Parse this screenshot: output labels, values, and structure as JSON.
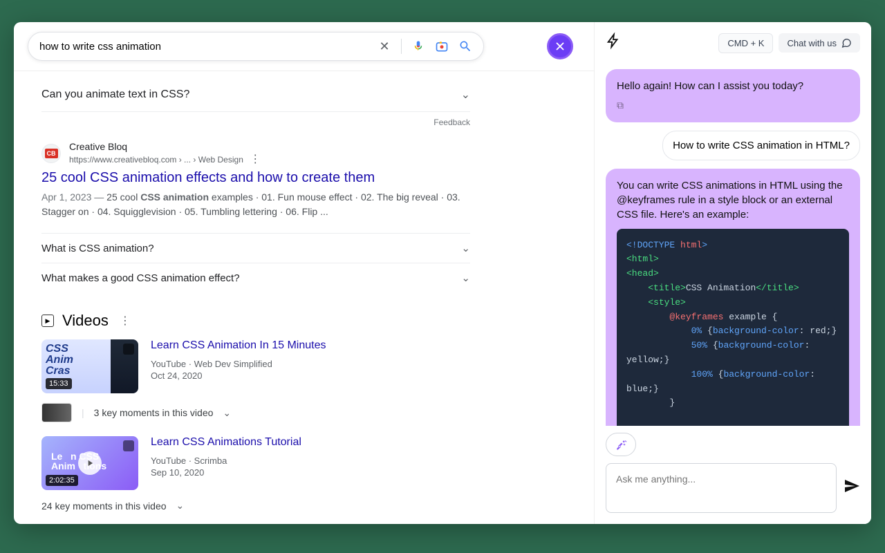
{
  "search": {
    "query": "how to write css animation",
    "feedback": "Feedback"
  },
  "paa_top": "Can you animate text in CSS?",
  "result1": {
    "source_name": "Creative Bloq",
    "source_url": "https://www.creativebloq.com › ... › Web Design",
    "favicon_text": "CB",
    "title": "25 cool CSS animation effects and how to create them",
    "date": "Apr 1, 2023",
    "snippet_lead": "25 cool ",
    "snippet_bold": "CSS animation",
    "snippet_rest": " examples · 01. Fun mouse effect · 02. The big reveal · 03. Stagger on · 04. Squigglevision · 05. Tumbling lettering · 06. Flip ..."
  },
  "sub_paa": [
    "What is CSS animation?",
    "What makes a good CSS animation effect?"
  ],
  "videos": {
    "header": "Videos",
    "items": [
      {
        "title": "Learn CSS Animation In 15 Minutes",
        "thumb_text": "CSS\nAnim\nCras",
        "duration": "15:33",
        "source": "YouTube",
        "channel": "Web Dev Simplified",
        "date": "Oct 24, 2020",
        "moments": "3 key moments in this video"
      },
      {
        "title": "Learn CSS Animations Tutorial",
        "thumb_text": "Le   n CSS\nAnim   tions",
        "duration": "2:02:35",
        "source": "YouTube",
        "channel": "Scrimba",
        "date": "Sep 10, 2020",
        "moments": "24 key moments in this video"
      }
    ]
  },
  "chat": {
    "cmd_btn": "CMD + K",
    "chat_with_us": "Chat with us",
    "greeting": "Hello again! How can I assist you today?",
    "user_msg": "How to write CSS animation in HTML?",
    "bot_intro": "You can write CSS animations in HTML using the @keyframes rule in a style block or an external CSS file. Here's an example:",
    "placeholder": "Ask me anything..."
  }
}
